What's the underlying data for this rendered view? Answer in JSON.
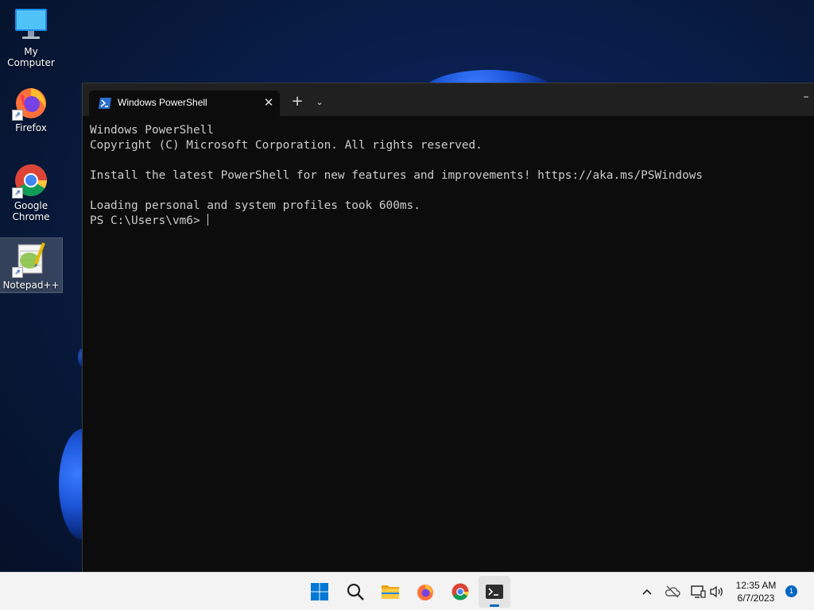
{
  "desktop": {
    "icons": [
      {
        "label": "My Computer",
        "icon": "monitor-icon"
      },
      {
        "label": "Firefox",
        "icon": "firefox-icon"
      },
      {
        "label": "Google\nChrome",
        "icon": "chrome-icon"
      },
      {
        "label": "Notepad++",
        "icon": "notepadpp-icon"
      }
    ]
  },
  "terminal": {
    "tab_title": "Windows PowerShell",
    "new_tab_glyph": "+",
    "dropdown_glyph": "⌄",
    "close_glyph": "✕",
    "minimize_glyph": "–",
    "lines": [
      "Windows PowerShell",
      "Copyright (C) Microsoft Corporation. All rights reserved.",
      "",
      "Install the latest PowerShell for new features and improvements! https://aka.ms/PSWindows",
      "",
      "Loading personal and system profiles took 600ms.",
      "PS C:\\Users\\vm6> "
    ]
  },
  "taskbar": {
    "items": [
      {
        "icon": "windows-start-icon"
      },
      {
        "icon": "search-icon"
      },
      {
        "icon": "file-explorer-icon"
      },
      {
        "icon": "firefox-icon"
      },
      {
        "icon": "chrome-icon"
      },
      {
        "icon": "terminal-icon",
        "active": true
      }
    ],
    "tray": [
      "chevron-up-icon",
      "onedrive-icon",
      "network-icon",
      "volume-icon"
    ],
    "time": "12:35 AM",
    "date": "6/7/2023",
    "notification_count": "1"
  },
  "colors": {
    "console_bg": "#0c0c0c",
    "console_fg": "#cccccc",
    "taskbar_bg": "#f3f3f3",
    "accent": "#0067c0"
  }
}
